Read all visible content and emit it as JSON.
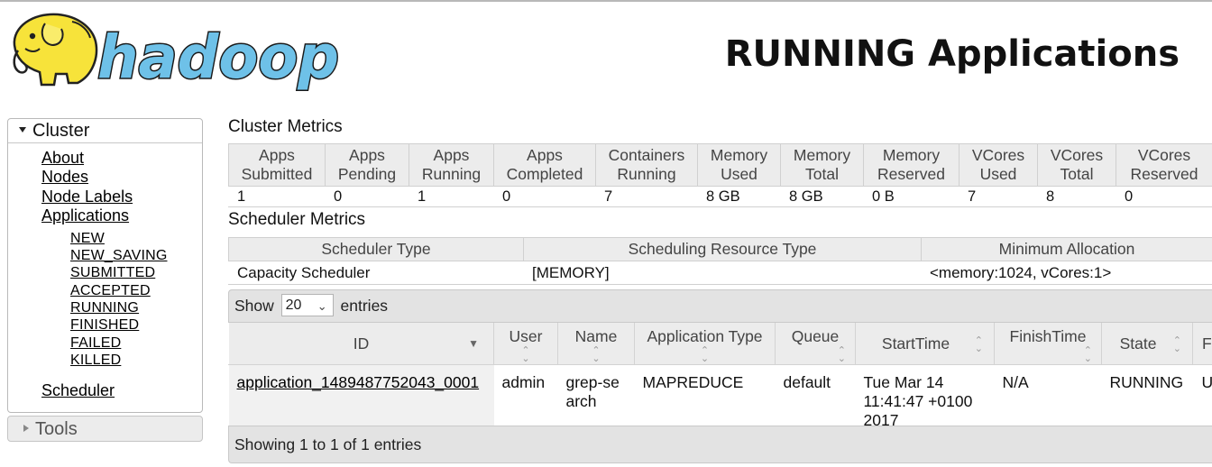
{
  "header": {
    "logo_text": "hadoop",
    "title": "RUNNING Applications"
  },
  "sidebar": {
    "cluster_label": "Cluster",
    "links": [
      "About",
      "Nodes",
      "Node Labels",
      "Applications"
    ],
    "app_states": [
      "NEW",
      "NEW_SAVING",
      "SUBMITTED",
      "ACCEPTED",
      "RUNNING",
      "FINISHED",
      "FAILED",
      "KILLED"
    ],
    "scheduler_label": "Scheduler",
    "tools_label": "Tools"
  },
  "cluster_metrics": {
    "title": "Cluster Metrics",
    "headers": [
      [
        "Apps",
        "Submitted"
      ],
      [
        "Apps",
        "Pending"
      ],
      [
        "Apps",
        "Running"
      ],
      [
        "Apps",
        "Completed"
      ],
      [
        "Containers",
        "Running"
      ],
      [
        "Memory",
        "Used"
      ],
      [
        "Memory",
        "Total"
      ],
      [
        "Memory",
        "Reserved"
      ],
      [
        "VCores",
        "Used"
      ],
      [
        "VCores",
        "Total"
      ],
      [
        "VCores",
        "Reserved"
      ]
    ],
    "values": [
      "1",
      "0",
      "1",
      "0",
      "7",
      "8 GB",
      "8 GB",
      "0 B",
      "7",
      "8",
      "0"
    ]
  },
  "scheduler_metrics": {
    "title": "Scheduler Metrics",
    "headers": [
      "Scheduler Type",
      "Scheduling Resource Type",
      "Minimum Allocation"
    ],
    "values": [
      "Capacity Scheduler",
      "[MEMORY]",
      "<memory:1024, vCores:1>"
    ]
  },
  "apps_table": {
    "show_label": "Show",
    "entries_value": "20",
    "entries_label": "entries",
    "columns": [
      "ID",
      "User",
      "Name",
      "Application Type",
      "Queue",
      "StartTime",
      "FinishTime",
      "State",
      "F"
    ],
    "rows": [
      {
        "id": "application_1489487752043_0001",
        "user": "admin",
        "name": "grep-search",
        "type": "MAPREDUCE",
        "queue": "default",
        "start_time": "Tue Mar 14 11:41:47 +0100 2017",
        "finish_time": "N/A",
        "state": "RUNNING",
        "final_status": "U"
      }
    ],
    "footer_text": "Showing 1 to 1 of 1 entries"
  },
  "colors": {
    "logo_yellow": "#f7e33a",
    "logo_blue": "#6ec1e8",
    "header_gray": "#ececec"
  }
}
